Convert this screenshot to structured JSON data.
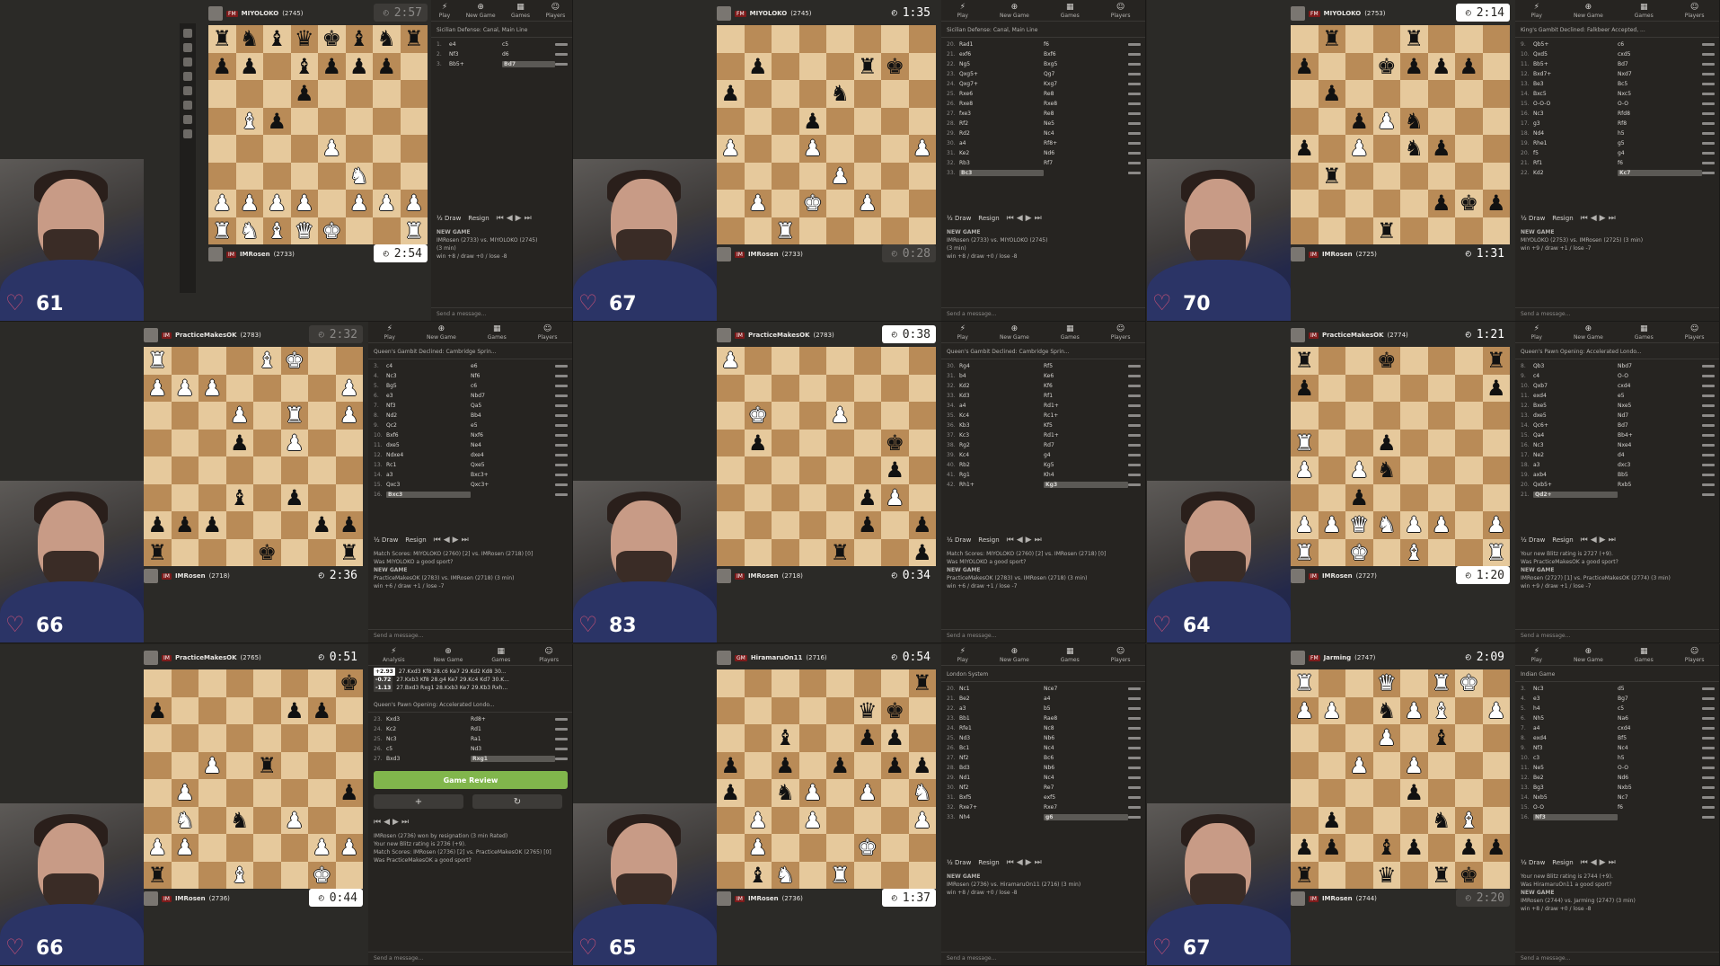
{
  "app": {
    "title": "Chess.com live blitz — 9 game grid"
  },
  "tiles": [
    {
      "viewers": "61",
      "top": {
        "title": "FM",
        "name": "MIYOLOKO",
        "rating": "(2745)",
        "clock": "2:57",
        "clock_style": "dim"
      },
      "bottom": {
        "title": "IM",
        "name": "IMRosen",
        "rating": "(2733)",
        "clock": "2:54",
        "clock_style": "light"
      },
      "opening": "Sicilian Defense: Canal, Main Line",
      "moves": [
        [
          "1.",
          "e4",
          "c5"
        ],
        [
          "2.",
          "Nf3",
          "d6"
        ],
        [
          "3.",
          "Bb5+",
          "Bd7"
        ]
      ],
      "info": [
        "NEW GAME",
        "IMRosen (2733) vs. MIYOLOKO (2745)",
        "(3 min)",
        "win +8 / draw +0 / lose -8"
      ],
      "board": "rnbqkbnr/pp1bppp1/3p4/1Bp5/4P3/5N2/PPPP1PPP/RNBQK2R",
      "flipped": false
    },
    {
      "viewers": "67",
      "top": {
        "title": "FM",
        "name": "MIYOLOKO",
        "rating": "(2745)",
        "clock": "1:35",
        "clock_style": "plain"
      },
      "bottom": {
        "title": "IM",
        "name": "IMRosen",
        "rating": "(2733)",
        "clock": "0:28",
        "clock_style": "dim"
      },
      "opening": "Sicilian Defense: Canal, Main Line",
      "moves": [
        [
          "20.",
          "Rad1",
          "f6"
        ],
        [
          "21.",
          "exf6",
          "Bxf6"
        ],
        [
          "22.",
          "Ng5",
          "Bxg5"
        ],
        [
          "23.",
          "Qxg5+",
          "Qg7"
        ],
        [
          "24.",
          "Qxg7+",
          "Kxg7"
        ],
        [
          "25.",
          "Rxe6",
          "Re8"
        ],
        [
          "26.",
          "Rxe8",
          "Rxe8"
        ],
        [
          "27.",
          "fxe3",
          "Re8"
        ],
        [
          "28.",
          "Rf2",
          "Ne5"
        ],
        [
          "29.",
          "Rd2",
          "Nc4"
        ],
        [
          "30.",
          "a4",
          "Rf8+"
        ],
        [
          "31.",
          "Ke2",
          "Nd6"
        ],
        [
          "32.",
          "Rb3",
          "Rf7"
        ],
        [
          "33.",
          "Bc3",
          ""
        ]
      ],
      "info": [
        "NEW GAME",
        "IMRosen (2733) vs. MIYOLOKO (2745)",
        "(3 min)",
        "win +8 / draw +0 / lose -8"
      ],
      "board": "8/1p3rk1/p3n3/3p4/P2P3P/4P3/1P1K1P2/2R5",
      "flipped": false
    },
    {
      "viewers": "70",
      "top": {
        "title": "FM",
        "name": "MIYOLOKO",
        "rating": "(2753)",
        "clock": "2:14",
        "clock_style": "light"
      },
      "bottom": {
        "title": "IM",
        "name": "IMRosen",
        "rating": "(2725)",
        "clock": "1:31",
        "clock_style": "plain"
      },
      "opening": "King's Gambit Declined: Falkbeer Accepted, ...",
      "moves": [
        [
          "9.",
          "Qb5+",
          "c6"
        ],
        [
          "10.",
          "Qxd5",
          "cxd5"
        ],
        [
          "11.",
          "Bb5+",
          "Bd7"
        ],
        [
          "12.",
          "Bxd7+",
          "Nxd7"
        ],
        [
          "13.",
          "Be3",
          "Bc5"
        ],
        [
          "14.",
          "Bxc5",
          "Nxc5"
        ],
        [
          "15.",
          "O-O-O",
          "O-O"
        ],
        [
          "16.",
          "Nc3",
          "Rfd8"
        ],
        [
          "17.",
          "g3",
          "Rf8"
        ],
        [
          "18.",
          "Nd4",
          "h5"
        ],
        [
          "19.",
          "Rhe1",
          "g5"
        ],
        [
          "20.",
          "f5",
          "g4"
        ],
        [
          "21.",
          "Rf1",
          "f6"
        ],
        [
          "22.",
          "Kd2",
          "Kc7"
        ]
      ],
      "info": [
        "NEW GAME",
        "MIYOLOKO (2753) vs. IMRosen (2725) (3 min)",
        "win +9 / draw +1 / lose -7"
      ],
      "board": "1r2r3/p2kppp1/1p6/2pPn3/p1P1np2/1r6/5pkp/3r4",
      "flipped": true
    },
    {
      "viewers": "66",
      "top": {
        "title": "IM",
        "name": "PracticeMakesOK",
        "rating": "(2783)",
        "clock": "2:32",
        "clock_style": "dim"
      },
      "bottom": {
        "title": "IM",
        "name": "IMRosen",
        "rating": "(2718)",
        "clock": "2:36",
        "clock_style": "plain"
      },
      "opening": "Queen's Gambit Declined: Cambridge Sprin...",
      "moves": [
        [
          "3.",
          "c4",
          "e6"
        ],
        [
          "4.",
          "Nc3",
          "Nf6"
        ],
        [
          "5.",
          "Bg5",
          "c6"
        ],
        [
          "6.",
          "e3",
          "Nbd7"
        ],
        [
          "7.",
          "Nf3",
          "Qa5"
        ],
        [
          "8.",
          "Nd2",
          "Bb4"
        ],
        [
          "9.",
          "Qc2",
          "e5"
        ],
        [
          "10.",
          "Bxf6",
          "Nxf6"
        ],
        [
          "11.",
          "dxe5",
          "Ne4"
        ],
        [
          "12.",
          "Ndxe4",
          "dxe4"
        ],
        [
          "13.",
          "Rc1",
          "Qxe5"
        ],
        [
          "14.",
          "a3",
          "Bxc3+"
        ],
        [
          "15.",
          "Qxc3",
          "Qxc3+"
        ],
        [
          "16.",
          "Bxc3",
          ""
        ]
      ],
      "info": [
        "Match Scores: MIYOLOKO (2760) [2] vs. IMRosen (2718) [0]",
        "Was MIYOLOKO a good sport?",
        "NEW GAME",
        "PracticeMakesOK (2783) vs. IMRosen (2718) (3 min)",
        "win +6 / draw +1 / lose -7"
      ],
      "board": "R3BK2/PPP4P/3P1R1P/3p1P2/8/3b1p2/ppp3pp/r3k2r",
      "flipped": true
    },
    {
      "viewers": "83",
      "top": {
        "title": "IM",
        "name": "PracticeMakesOK",
        "rating": "(2783)",
        "clock": "0:38",
        "clock_style": "light"
      },
      "bottom": {
        "title": "IM",
        "name": "IMRosen",
        "rating": "(2718)",
        "clock": "0:34",
        "clock_style": "plain"
      },
      "opening": "Queen's Gambit Declined: Cambridge Sprin...",
      "moves": [
        [
          "30.",
          "Rg4",
          "Rf5"
        ],
        [
          "31.",
          "b4",
          "Ke6"
        ],
        [
          "32.",
          "Kd2",
          "Kf6"
        ],
        [
          "33.",
          "Kd3",
          "Rf1"
        ],
        [
          "34.",
          "a4",
          "Rd1+"
        ],
        [
          "35.",
          "Kc4",
          "Rc1+"
        ],
        [
          "36.",
          "Kb3",
          "Kf5"
        ],
        [
          "37.",
          "Kc3",
          "Rd1+"
        ],
        [
          "38.",
          "Rg2",
          "Rd7"
        ],
        [
          "39.",
          "Kc4",
          "g4"
        ],
        [
          "40.",
          "Rb2",
          "Kg5"
        ],
        [
          "41.",
          "Rg1",
          "Kh4"
        ],
        [
          "42.",
          "Rh1+",
          "Kg3"
        ]
      ],
      "info": [
        "Match Scores: MIYOLOKO (2760) [2] vs. IMRosen (2718) [0]",
        "Was MIYOLOKO a good sport?",
        "NEW GAME",
        "PracticeMakesOK (2783) vs. IMRosen (2718) (3 min)",
        "win +6 / draw +1 / lose -7"
      ],
      "board": "P7/8/1K2P3/1p4k1/6p1/5pP1/5p1p/4r2p",
      "flipped": true
    },
    {
      "viewers": "64",
      "top": {
        "title": "IM",
        "name": "PracticeMakesOK",
        "rating": "(2774)",
        "clock": "1:21",
        "clock_style": "plain"
      },
      "bottom": {
        "title": "IM",
        "name": "IMRosen",
        "rating": "(2727)",
        "clock": "1:20",
        "clock_style": "light"
      },
      "opening": "Queen's Pawn Opening: Accelerated Londo...",
      "moves": [
        [
          "8.",
          "Qb3",
          "Nbd7"
        ],
        [
          "9.",
          "c4",
          "O-O"
        ],
        [
          "10.",
          "Qxb7",
          "cxd4"
        ],
        [
          "11.",
          "exd4",
          "e5"
        ],
        [
          "12.",
          "Bxe5",
          "Nxe5"
        ],
        [
          "13.",
          "dxe5",
          "Nd7"
        ],
        [
          "14.",
          "Qc6+",
          "Bd7"
        ],
        [
          "15.",
          "Qa4",
          "Bb4+"
        ],
        [
          "16.",
          "Nc3",
          "Nxe4"
        ],
        [
          "17.",
          "Ne2",
          "d4"
        ],
        [
          "18.",
          "a3",
          "dxc3"
        ],
        [
          "19.",
          "axb4",
          "Bb5"
        ],
        [
          "20.",
          "Qxb5+",
          "Rxb5"
        ],
        [
          "21.",
          "Qd2+",
          ""
        ]
      ],
      "info": [
        "Your new Blitz rating is 2727 (+9).",
        "Was PracticeMakesOK a good sport?",
        "NEW GAME",
        "IMRosen (2727) [1] vs. PracticeMakesOK (2774) (3 min)",
        "win +9 / draw +1 / lose -7"
      ],
      "board": "r2k3r/p6p/8/R2p4/P1Pn4/2p5/PPQNPP1P/R1K1B2R",
      "flipped": false
    },
    {
      "viewers": "66",
      "top": {
        "title": "IM",
        "name": "PracticeMakesOK",
        "rating": "(2765)",
        "clock": "0:51",
        "clock_style": "plain"
      },
      "bottom": {
        "title": "IM",
        "name": "IMRosen",
        "rating": "(2736)",
        "clock": "0:44",
        "clock_style": "light"
      },
      "opening": "Queen's Pawn Opening: Accelerated Londo...",
      "evals": [
        [
          "+2.93",
          "27.Kxd3 Kf8 28.c6 Ke7 29.Kd2 Kd8 30..."
        ],
        [
          "-0.72",
          "27.Kxb3 Kf8 28.g4 Ke7 29.Kc4 Kd7 30.K..."
        ],
        [
          "-1.13",
          "27.Bxd3 Rxg1 28.Kxb3 Ke7 29.Kb3 Rxh..."
        ]
      ],
      "moves": [
        [
          "23.",
          "Kxd3",
          "Rd8+"
        ],
        [
          "24.",
          "Kc2",
          "Rd1"
        ],
        [
          "25.",
          "Nc3",
          "Ra1"
        ],
        [
          "26.",
          "c5",
          "Nd3"
        ],
        [
          "27.",
          "Bxd3",
          "Rxg1"
        ]
      ],
      "review": "Game Review",
      "info": [
        "IMRosen (2736) won by resignation (3 min Rated)",
        "Your new Blitz rating is 2736 (+9).",
        "Match Scores: IMRosen (2736) [2] vs. PracticeMakesOK (2765) [0]",
        "Was PracticeMakesOK a good sport?"
      ],
      "board": "7k/p4pp1/8/2P1r3/1P5p/1N1n1P2/PP4PP/r2B2K1",
      "flipped": false
    },
    {
      "viewers": "65",
      "top": {
        "title": "GM",
        "name": "HiramaruOn11",
        "rating": "(2716)",
        "clock": "0:54",
        "clock_style": "plain"
      },
      "bottom": {
        "title": "IM",
        "name": "IMRosen",
        "rating": "(2736)",
        "clock": "1:37",
        "clock_style": "light"
      },
      "opening": "London System",
      "moves": [
        [
          "20.",
          "Nc1",
          "Nce7"
        ],
        [
          "21.",
          "Be2",
          "a4"
        ],
        [
          "22.",
          "a3",
          "b5"
        ],
        [
          "23.",
          "Bb1",
          "Rae8"
        ],
        [
          "24.",
          "Rfe1",
          "Nc8"
        ],
        [
          "25.",
          "Nd3",
          "Nb6"
        ],
        [
          "26.",
          "Bc1",
          "Nc4"
        ],
        [
          "27.",
          "Nf2",
          "Bc6"
        ],
        [
          "28.",
          "Bd3",
          "Nb6"
        ],
        [
          "29.",
          "Nd1",
          "Nc4"
        ],
        [
          "30.",
          "Nf2",
          "Re7"
        ],
        [
          "31.",
          "Bxf5",
          "exf5"
        ],
        [
          "32.",
          "Rxe7+",
          "Rxe7"
        ],
        [
          "33.",
          "Nh4",
          "g6"
        ]
      ],
      "info": [
        "NEW GAME",
        "IMRosen (2736) vs. HiramaruOn11 (2716) (3 min)",
        "win +8 / draw +0 / lose -8"
      ],
      "board": "7r/5qk1/2b2pp1/p1p1p1pp/p1nP1P1N/1P1P3P/1P3K2/1bN1R3",
      "flipped": false
    },
    {
      "viewers": "67",
      "top": {
        "title": "FM",
        "name": "Jarming",
        "rating": "(2747)",
        "clock": "2:09",
        "clock_style": "plain"
      },
      "bottom": {
        "title": "IM",
        "name": "IMRosen",
        "rating": "(2744)",
        "clock": "2:20",
        "clock_style": "dim"
      },
      "opening": "Indian Game",
      "moves": [
        [
          "3.",
          "Nc3",
          "d5"
        ],
        [
          "4.",
          "e3",
          "Bg7"
        ],
        [
          "5.",
          "h4",
          "c5"
        ],
        [
          "6.",
          "Nh5",
          "Na6"
        ],
        [
          "7.",
          "a4",
          "cxd4"
        ],
        [
          "8.",
          "exd4",
          "Bf5"
        ],
        [
          "9.",
          "Nf3",
          "Nc4"
        ],
        [
          "10.",
          "c3",
          "h5"
        ],
        [
          "11.",
          "Ne5",
          "O-O"
        ],
        [
          "12.",
          "Be2",
          "Nd6"
        ],
        [
          "13.",
          "Bg3",
          "Nxb5"
        ],
        [
          "14.",
          "Nxb5",
          "Nc7"
        ],
        [
          "15.",
          "O-O",
          "f6"
        ],
        [
          "16.",
          "Nf3",
          ""
        ]
      ],
      "info": [
        "Your new Blitz rating is 2744 (+9).",
        "Was HiramaruOn11 a good sport?",
        "NEW GAME",
        "IMRosen (2744) vs. Jarming (2747) (3 min)",
        "win +8 / draw +0 / lose -8"
      ],
      "board": "R2Q1RK1/PP1nPB1P/3P1b2/2P1P3/4p3/1p3nB1/pp1bp1pp/r2q1rk1",
      "flipped": true
    }
  ],
  "labels": {
    "tab_play": "Play",
    "tab_new": "New Game",
    "tab_games": "Games",
    "tab_players": "Players",
    "tab_analysis": "Analysis",
    "draw": "½ Draw",
    "resign": "Resign",
    "send": "Send a message...",
    "new_game": "NEW GAME"
  }
}
